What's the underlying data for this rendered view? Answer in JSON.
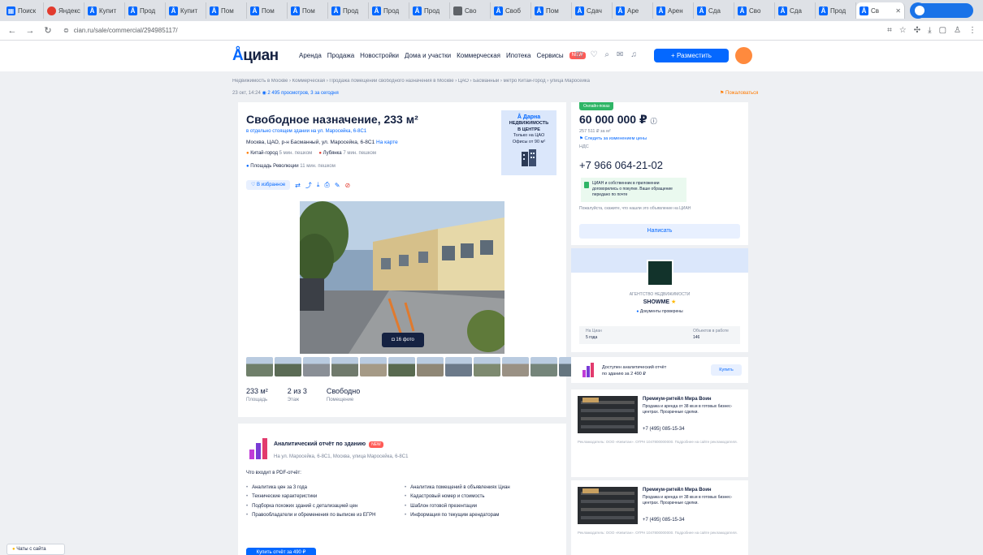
{
  "browser": {
    "tabs": [
      {
        "label": "Поиск",
        "icon": "grid"
      },
      {
        "label": "Яндекс",
        "icon": "red"
      },
      {
        "label": "Купит",
        "icon": "cian"
      },
      {
        "label": "Прод",
        "icon": "cian"
      },
      {
        "label": "Купит",
        "icon": "cian"
      },
      {
        "label": "Пом",
        "icon": "cian"
      },
      {
        "label": "Пом",
        "icon": "cian"
      },
      {
        "label": "Пом",
        "icon": "cian"
      },
      {
        "label": "Прод",
        "icon": "cian"
      },
      {
        "label": "Прод",
        "icon": "cian"
      },
      {
        "label": "Прод",
        "icon": "cian"
      },
      {
        "label": "Сво",
        "icon": "grey"
      },
      {
        "label": "Своб",
        "icon": "cian"
      },
      {
        "label": "Пом",
        "icon": "cian"
      },
      {
        "label": "Сдач",
        "icon": "cian"
      },
      {
        "label": "Аре",
        "icon": "cian"
      },
      {
        "label": "Арен",
        "icon": "cian"
      },
      {
        "label": "Сда",
        "icon": "cian"
      },
      {
        "label": "Сво",
        "icon": "cian"
      },
      {
        "label": "Сда",
        "icon": "cian"
      },
      {
        "label": "Прод",
        "icon": "cian"
      },
      {
        "label": "Св",
        "icon": "cian",
        "active": true
      }
    ],
    "url": "cian.ru/sale/commercial/294985117/"
  },
  "header": {
    "logo": "циан",
    "nav": [
      "Аренда",
      "Продажа",
      "Новостройки",
      "Дома и участки",
      "Коммерческая",
      "Ипотека",
      "Сервисы"
    ],
    "nav_new": "NEW",
    "post_button": "+ Разместить объявление"
  },
  "breadcrumb": "Недвижимость в Москве › Коммерческая › Продажа помещений свободного назначения в Москве › ЦАО › Басманный › метро Китай-город › улица Маросейка",
  "meta": {
    "date": "23 окт, 14:24",
    "views": "2 495 просмотров, 3 за сегодня",
    "complain": "Пожаловаться"
  },
  "listing": {
    "title": "Свободное назначение, 233 м²",
    "subtitle": "в отдельно стоящем здании на ул. Маросейка, 6-8С1",
    "address": "Москва, ЦАО, р-н Басманный, ул. Маросейка, 6-8С1",
    "address_map": "На карте",
    "metro": [
      {
        "name": "Китай-город",
        "time": "5 мин. пешком",
        "color": "#ff7a00"
      },
      {
        "name": "Лубянка",
        "time": "7 мин. пешком",
        "color": "#e23b2e"
      }
    ],
    "metro_extra": {
      "name": "Площадь Революции",
      "time": "11 мин. пешком"
    },
    "favorite": "В избранное",
    "developer": {
      "name": "Дарна",
      "line1": "НЕДВИЖИМОСТЬ",
      "line2": "В ЦЕНТРЕ",
      "line3": "Только на ЦАО",
      "line4": "Офисы от 90 м²"
    },
    "photo_count": "16 фото",
    "thumb_colors": [
      "#6f7f6a",
      "#5b6b55",
      "#8a8f96",
      "#707a6c",
      "#a59a86",
      "#596a50",
      "#8f8776",
      "#6c7a8a",
      "#7e8a70",
      "#9a9184",
      "#75857a",
      "#65757f"
    ],
    "stats": [
      {
        "value": "233 м²",
        "label": "Площадь"
      },
      {
        "value": "2 из 3",
        "label": "Этаж"
      },
      {
        "value": "Свободно",
        "label": "Помещение"
      }
    ]
  },
  "report": {
    "title": "Аналитический отчёт по зданию",
    "badge": "NEW",
    "address": "На ул. Маросейка, 6-8С1, Москва, улица Маросейка, 6-8С1",
    "subtitle": "Что входит в PDF-отчёт:",
    "left": [
      "Аналитика цен за 3 года",
      "Технические характеристики",
      "Подборка похожих зданий с детализацией цен",
      "Правообладатели и обременения по выписке из ЕГРН"
    ],
    "right": [
      "Аналитика помещений в объявлениях Циан",
      "Кадастровый номер и стоимость",
      "Шаблон готовой презентации",
      "Информация по текущим арендаторам"
    ],
    "button": "Купить отчёт за 490 ₽"
  },
  "price_card": {
    "badge": "Онлайн-показ",
    "price": "60 000 000 ₽",
    "per_m": "257 511 ₽ за м²",
    "follow": "Следить за изменением цены",
    "tax": "НДС",
    "phone": "+7 966 064-21-02",
    "info": "ЦИАН и собственник в приложении договорились о покупке. Ваше обращение передано по почте",
    "tip": "Пожалуйста, скажите, что нашли это объявление на ЦИАН",
    "write": "Написать"
  },
  "agent": {
    "type": "АГЕНТСТВО НЕДВИЖИМОСТИ",
    "name": "SHOWME",
    "docs": "Документы проверены",
    "stat1_label": "На Циан",
    "stat1_value": "5 года",
    "stat2_label": "Объектов в работе",
    "stat2_value": "146"
  },
  "ad": {
    "text1": "Доступен аналитический отчёт",
    "text2": "по зданию за 2 490 ₽",
    "button": "Купить"
  },
  "promos": [
    {
      "title": "Премиум-ритейл Мира Воин",
      "desc": "Продажа и аренда от 38 кв.м в готовых бизнес-центрах. Прозрачные сделки.",
      "phone": "+7 (495) 085-15-34",
      "legal": "Рекламодатель: ООО «Кевитан». ОГРН 1047800000000. Подробнее на сайте рекламодателя."
    },
    {
      "title": "Премиум-ритейл Мира Воин",
      "desc": "Продажа и аренда от 38 кв.м в готовых бизнес-центрах. Прозрачные сделки.",
      "phone": "+7 (495) 085-15-34",
      "legal": "Рекламодатель: ООО «Кевитан». ОГРН 1047800000000. Подробнее на сайте рекламодателя."
    }
  ],
  "chat": "Чаты с сайта"
}
